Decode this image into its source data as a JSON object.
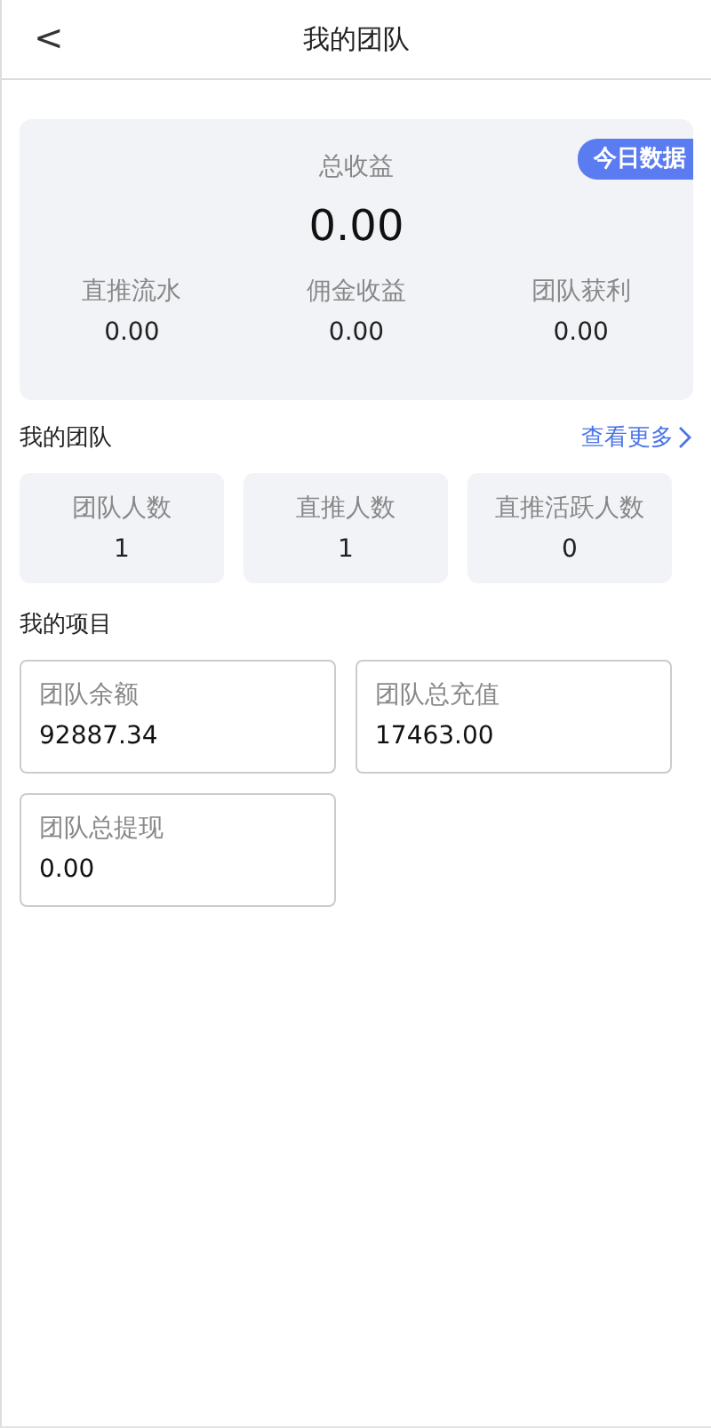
{
  "header": {
    "back": "<",
    "title": "我的团队"
  },
  "summary": {
    "badge": "今日数据",
    "title": "总收益",
    "amount": "0.00",
    "stats": [
      {
        "label": "直推流水",
        "value": "0.00"
      },
      {
        "label": "佣金收益",
        "value": "0.00"
      },
      {
        "label": "团队获利",
        "value": "0.00"
      }
    ]
  },
  "team": {
    "title": "我的团队",
    "more": "查看更多",
    "tiles": [
      {
        "label": "团队人数",
        "value": "1"
      },
      {
        "label": "直推人数",
        "value": "1"
      },
      {
        "label": "直推活跃人数",
        "value": "0"
      }
    ]
  },
  "projects": {
    "title": "我的项目",
    "cards": [
      {
        "label": "团队余额",
        "value": "92887.34"
      },
      {
        "label": "团队总充值",
        "value": "17463.00"
      },
      {
        "label": "团队总提现",
        "value": "0.00"
      }
    ]
  }
}
